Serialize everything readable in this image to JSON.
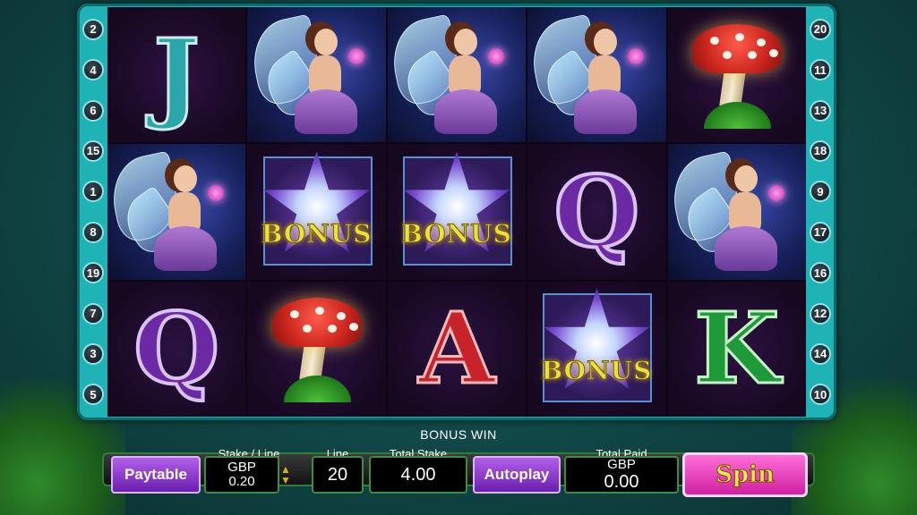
{
  "reels": [
    [
      "J",
      "fairy",
      "fairy",
      "fairy",
      "mushroom"
    ],
    [
      "fairy",
      "bonus",
      "bonus",
      "Q",
      "fairy"
    ],
    [
      "Q",
      "mushroom",
      "A",
      "bonus",
      "K"
    ]
  ],
  "bonus_symbol_label": "BONUS",
  "paylines": {
    "left": [
      "2",
      "4",
      "6",
      "15",
      "1",
      "8",
      "19",
      "7",
      "3",
      "5"
    ],
    "right": [
      "20",
      "11",
      "13",
      "18",
      "9",
      "17",
      "16",
      "12",
      "14",
      "10"
    ]
  },
  "panel": {
    "bonus_win_label": "BONUS WIN",
    "paytable_label": "Paytable",
    "stake_line_label": "Stake / Line",
    "stake_currency": "GBP",
    "stake_value": "0.20",
    "line_label": "Line",
    "line_value": "20",
    "total_stake_label": "Total Stake",
    "total_stake_value": "4.00",
    "autoplay_label": "Autoplay",
    "total_paid_label": "Total Paid",
    "total_paid_currency": "GBP",
    "total_paid_value": "0.00",
    "spin_label": "Spin"
  },
  "colors": {
    "frame": "#1fb3b5",
    "button_purple": "#8a3fd0",
    "spin_pink": "#e93cbf",
    "spin_text": "#ffe45a"
  }
}
